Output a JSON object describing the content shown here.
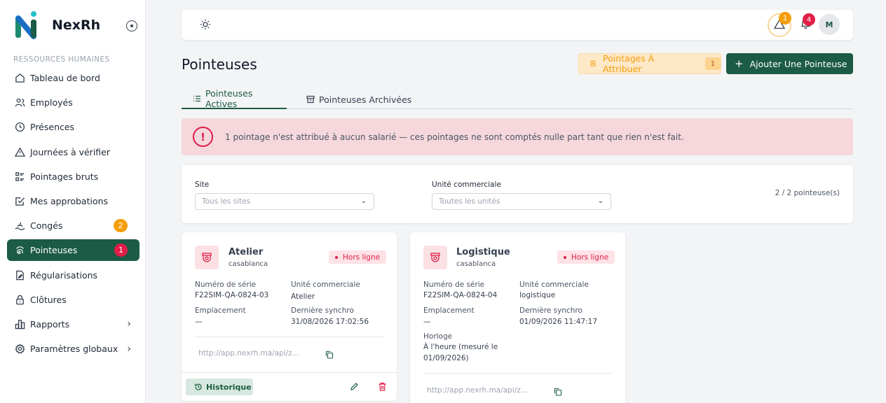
{
  "brand": {
    "name": "NexRh"
  },
  "sidebar": {
    "section": "RESSOURCES HUMAINES",
    "items": [
      {
        "label": "Tableau de bord",
        "icon": "home-icon"
      },
      {
        "label": "Employés",
        "icon": "users-icon"
      },
      {
        "label": "Présences",
        "icon": "clock-icon"
      },
      {
        "label": "Journées à vérifier",
        "icon": "warning-icon"
      },
      {
        "label": "Pointages bruts",
        "icon": "list-icon"
      },
      {
        "label": "Mes approbations",
        "icon": "check-square-icon"
      },
      {
        "label": "Congés",
        "icon": "beach-icon",
        "badge": "2",
        "badge_color": "#f59e0b"
      },
      {
        "label": "Pointeuses",
        "icon": "fingerprint-icon",
        "badge": "1",
        "badge_color": "#e11d48",
        "active": true
      },
      {
        "label": "Régularisations",
        "icon": "document-edit-icon"
      },
      {
        "label": "Clôtures",
        "icon": "lock-icon"
      },
      {
        "label": "Rapports",
        "icon": "bar-chart-icon",
        "chevron": true
      },
      {
        "label": "Paramètres globaux",
        "icon": "gear-icon",
        "chevron": true
      }
    ]
  },
  "topbar": {
    "warning_badge": "1",
    "notification_badge": "4",
    "avatar_initial": "M"
  },
  "page": {
    "title": "Pointeuses",
    "assign_button": "Pointages À Attribuer",
    "assign_count": "1",
    "add_button": "Ajouter Une Pointeuse"
  },
  "tabs": {
    "active": "Pointeuses Actives",
    "archived": "Pointeuses Archivées"
  },
  "alert": {
    "message": "1 pointage n'est attribué à aucun salarié — ces pointages ne sont comptés nulle part tant que rien n'est fait."
  },
  "filters": {
    "site_label": "Site",
    "site_placeholder": "Tous les sites",
    "unit_label": "Unité commerciale",
    "unit_placeholder": "Toutes les unités",
    "count": "2 / 2 pointeuse(s)"
  },
  "cards": [
    {
      "name": "Atelier",
      "site": "casablanca",
      "status": "Hors ligne",
      "serial_label": "Numéro de série",
      "serial": "F22SIM-QA-0824-03",
      "unit_label": "Unité commerciale",
      "unit": "Atelier",
      "location_label": "Emplacement",
      "location": "—",
      "sync_label": "Dernière synchro",
      "sync": "31/08/2026 17:02:56",
      "url": "http://app.nexrh.ma/api/z...",
      "history_button": "Historique"
    },
    {
      "name": "Logistique",
      "site": "casablanca",
      "status": "Hors ligne",
      "serial_label": "Numéro de série",
      "serial": "F22SIM-QA-0824-04",
      "unit_label": "Unité commerciale",
      "unit": "logistique",
      "location_label": "Emplacement",
      "location": "—",
      "sync_label": "Dernière synchro",
      "sync": "01/09/2026 11:47:17",
      "clock_label": "Horloge",
      "clock_line1": "À l'heure (mesuré le",
      "clock_line2": "01/09/2026)",
      "url": "http://app.nexrh.ma/api/z..."
    }
  ],
  "colors": {
    "primary": "#1c5b45",
    "danger": "#e11d48",
    "warning": "#f59e0b"
  }
}
